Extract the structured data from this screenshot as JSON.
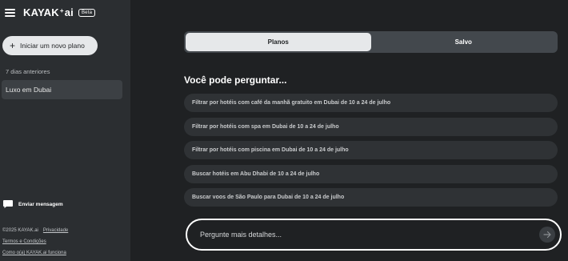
{
  "brand": {
    "logo_left": "KAYAK",
    "logo_star": "+",
    "logo_right": "ai",
    "beta_badge": "Beta"
  },
  "sidebar": {
    "new_plan_label": "Iniciar um novo plano",
    "section_label": "7 dias anteriores",
    "history": [
      {
        "label": "Luxo em Dubai"
      }
    ],
    "feedback_label": "Enviar mensagem",
    "footer": {
      "copyright": "©2025 KAYAK.ai",
      "privacy": "Privacidade",
      "terms": "Termos e Condições",
      "how_it_works": "Como o(a) KAYAK.ai funciona"
    }
  },
  "main": {
    "tabs": [
      {
        "label": "Planos",
        "active": true
      },
      {
        "label": "Salvo",
        "active": false
      }
    ],
    "suggest_title": "Você pode perguntar...",
    "suggestions": [
      "Filtrar por hotéis com café da manhã gratuito em Dubai de 10 a 24 de julho",
      "Filtrar por hotéis com spa em Dubai de 10 a 24 de julho",
      "Filtrar por hotéis com piscina em Dubai de 10 a 24 de julho",
      "Buscar hotéis em Abu Dhabi de 10 a 24 de julho",
      "Buscar voos de São Paulo para Dubai de 10 a 24 de julho"
    ],
    "ask_placeholder": "Pergunte mais detalhes..."
  },
  "icons": {
    "menu": "hamburger-menu-icon",
    "plus": "plus-icon",
    "chat": "chat-bubble-icon",
    "send": "arrow-right-icon"
  }
}
